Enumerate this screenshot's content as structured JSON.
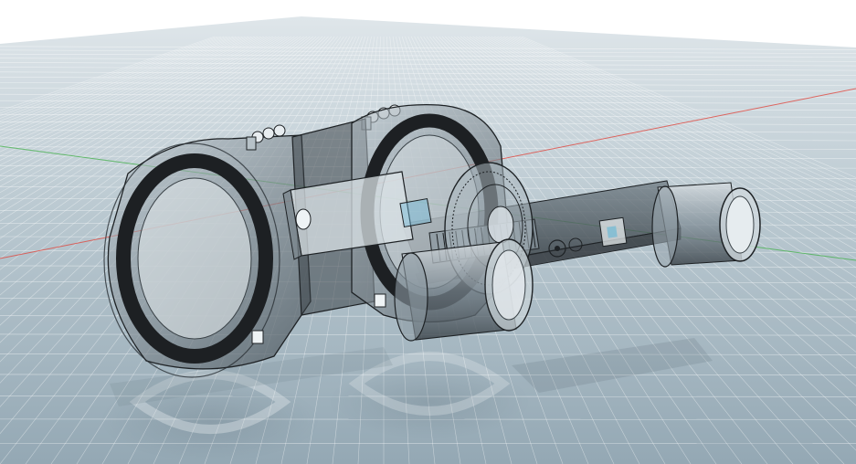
{
  "viewport": {
    "background": "#ffffff",
    "ground_color_near": "#9eb1bc",
    "ground_color_far": "#dfe6ea",
    "grid_color": "#ffffff",
    "axis_x_color": "#e0473f",
    "axis_y_color": "#47b24f",
    "model_color": "#2f3438",
    "model_glass_color": "#7f8e97",
    "rubber_ring_color": "#1d2023",
    "highlight_color": "#6fb9d6"
  },
  "scene": {
    "grid": "on",
    "ground_reflection": "on",
    "render_style": "x-ray / transparent shaded with edges",
    "model_parts": [
      "rear-ring-housing",
      "front-ring-housing",
      "hinge-brackets",
      "center-slide-block",
      "lead-screw",
      "focus-knob-wheel",
      "front-cylinder-cap",
      "extension-arm",
      "eyepiece-tube"
    ]
  }
}
